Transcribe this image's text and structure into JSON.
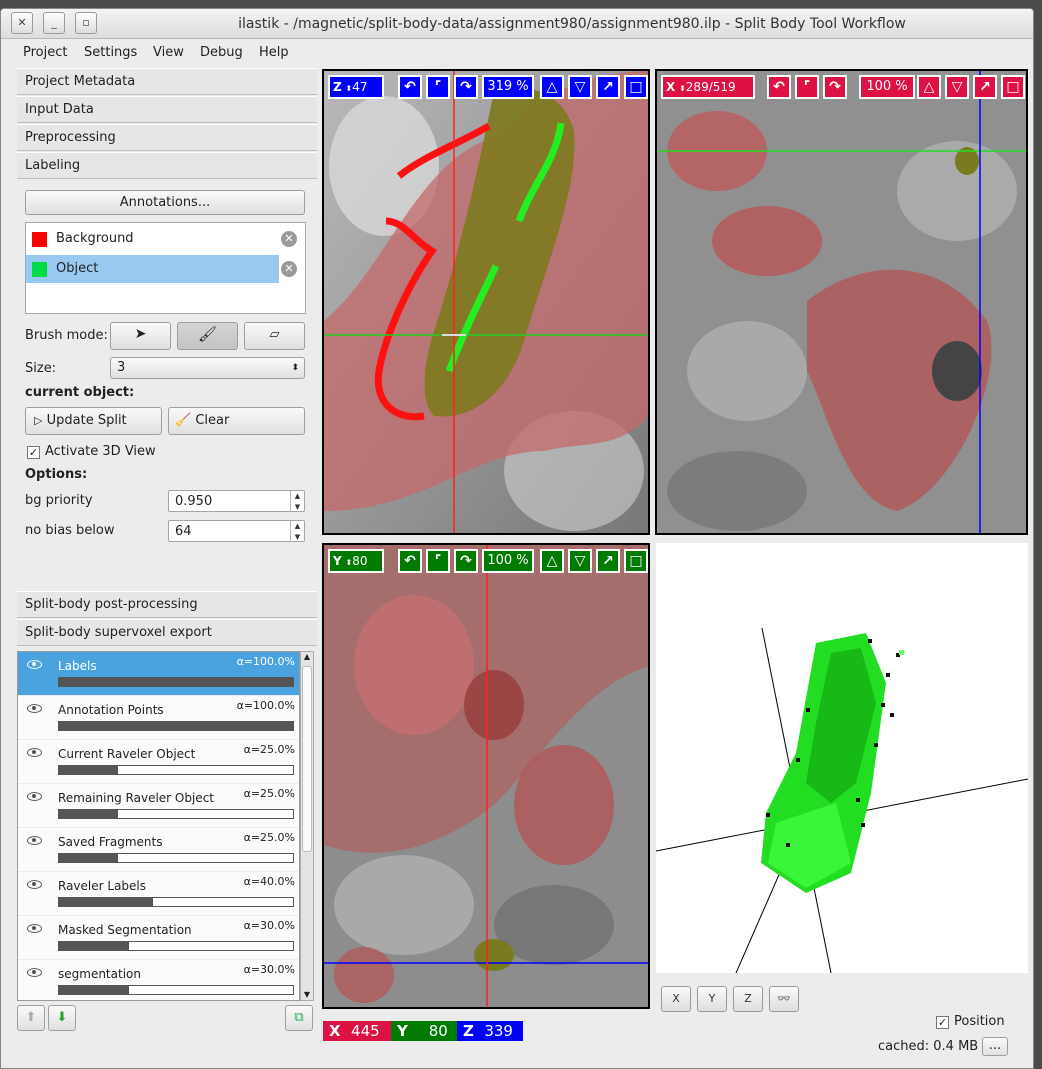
{
  "window": {
    "title": "ilastik - /magnetic/split-body-data/assignment980/assignment980.ilp - Split Body Tool Workflow",
    "close": "✕",
    "minimize": "_",
    "maximize": "▫"
  },
  "menus": [
    "Project",
    "Settings",
    "View",
    "Debug",
    "Help"
  ],
  "sections": {
    "project_metadata": "Project Metadata",
    "input_data": "Input Data",
    "preprocessing": "Preprocessing",
    "labeling": "Labeling",
    "post": "Split-body post-processing",
    "export": "Split-body supervoxel export"
  },
  "labeling": {
    "annotations_button": "Annotations...",
    "labels": [
      {
        "name": "Background",
        "color": "#ff0000"
      },
      {
        "name": "Object",
        "color": "#00dd44"
      }
    ],
    "brush_mode": "Brush mode:",
    "size_label": "Size:",
    "size_value": "3",
    "current_object": "current object:",
    "update_split": "Update Split",
    "clear": "Clear",
    "activate3d": "Activate 3D View",
    "options": "Options:",
    "bg_priority_label": "bg priority",
    "bg_priority_value": "0.950",
    "no_bias_label": "no bias below",
    "no_bias_value": "64"
  },
  "layers": [
    {
      "name": "Labels",
      "alpha": "α=100.0%",
      "opacity": 1.0,
      "selected": true
    },
    {
      "name": "Annotation Points",
      "alpha": "α=100.0%",
      "opacity": 1.0
    },
    {
      "name": "Current Raveler Object",
      "alpha": "α=25.0%",
      "opacity": 0.25
    },
    {
      "name": "Remaining Raveler Object",
      "alpha": "α=25.0%",
      "opacity": 0.25
    },
    {
      "name": "Saved Fragments",
      "alpha": "α=25.0%",
      "opacity": 0.25
    },
    {
      "name": "Raveler Labels",
      "alpha": "α=40.0%",
      "opacity": 0.4
    },
    {
      "name": "Masked Segmentation",
      "alpha": "α=30.0%",
      "opacity": 0.3
    },
    {
      "name": "segmentation",
      "alpha": "α=30.0%",
      "opacity": 0.3
    }
  ],
  "viewers": {
    "z": {
      "axis": "Z",
      "coord": "47",
      "zoom": "319 %",
      "color": "#0000ff"
    },
    "x": {
      "axis": "X",
      "coord": "289/519",
      "zoom": "100 %",
      "color": "#dd1144"
    },
    "y": {
      "axis": "Y",
      "coord": "80",
      "zoom": "100 %",
      "color": "#007a00"
    }
  },
  "axis_buttons": [
    "X",
    "Y",
    "Z"
  ],
  "position": {
    "x_label": "X",
    "x": "445",
    "y_label": "Y",
    "y": "80",
    "z_label": "Z",
    "z": "339"
  },
  "status": {
    "position_label": "Position",
    "cached": "cached: 0.4 MB",
    "more": "..."
  },
  "colors": {
    "selection": "#4aa3df",
    "label_selected": "#99c9f0"
  }
}
